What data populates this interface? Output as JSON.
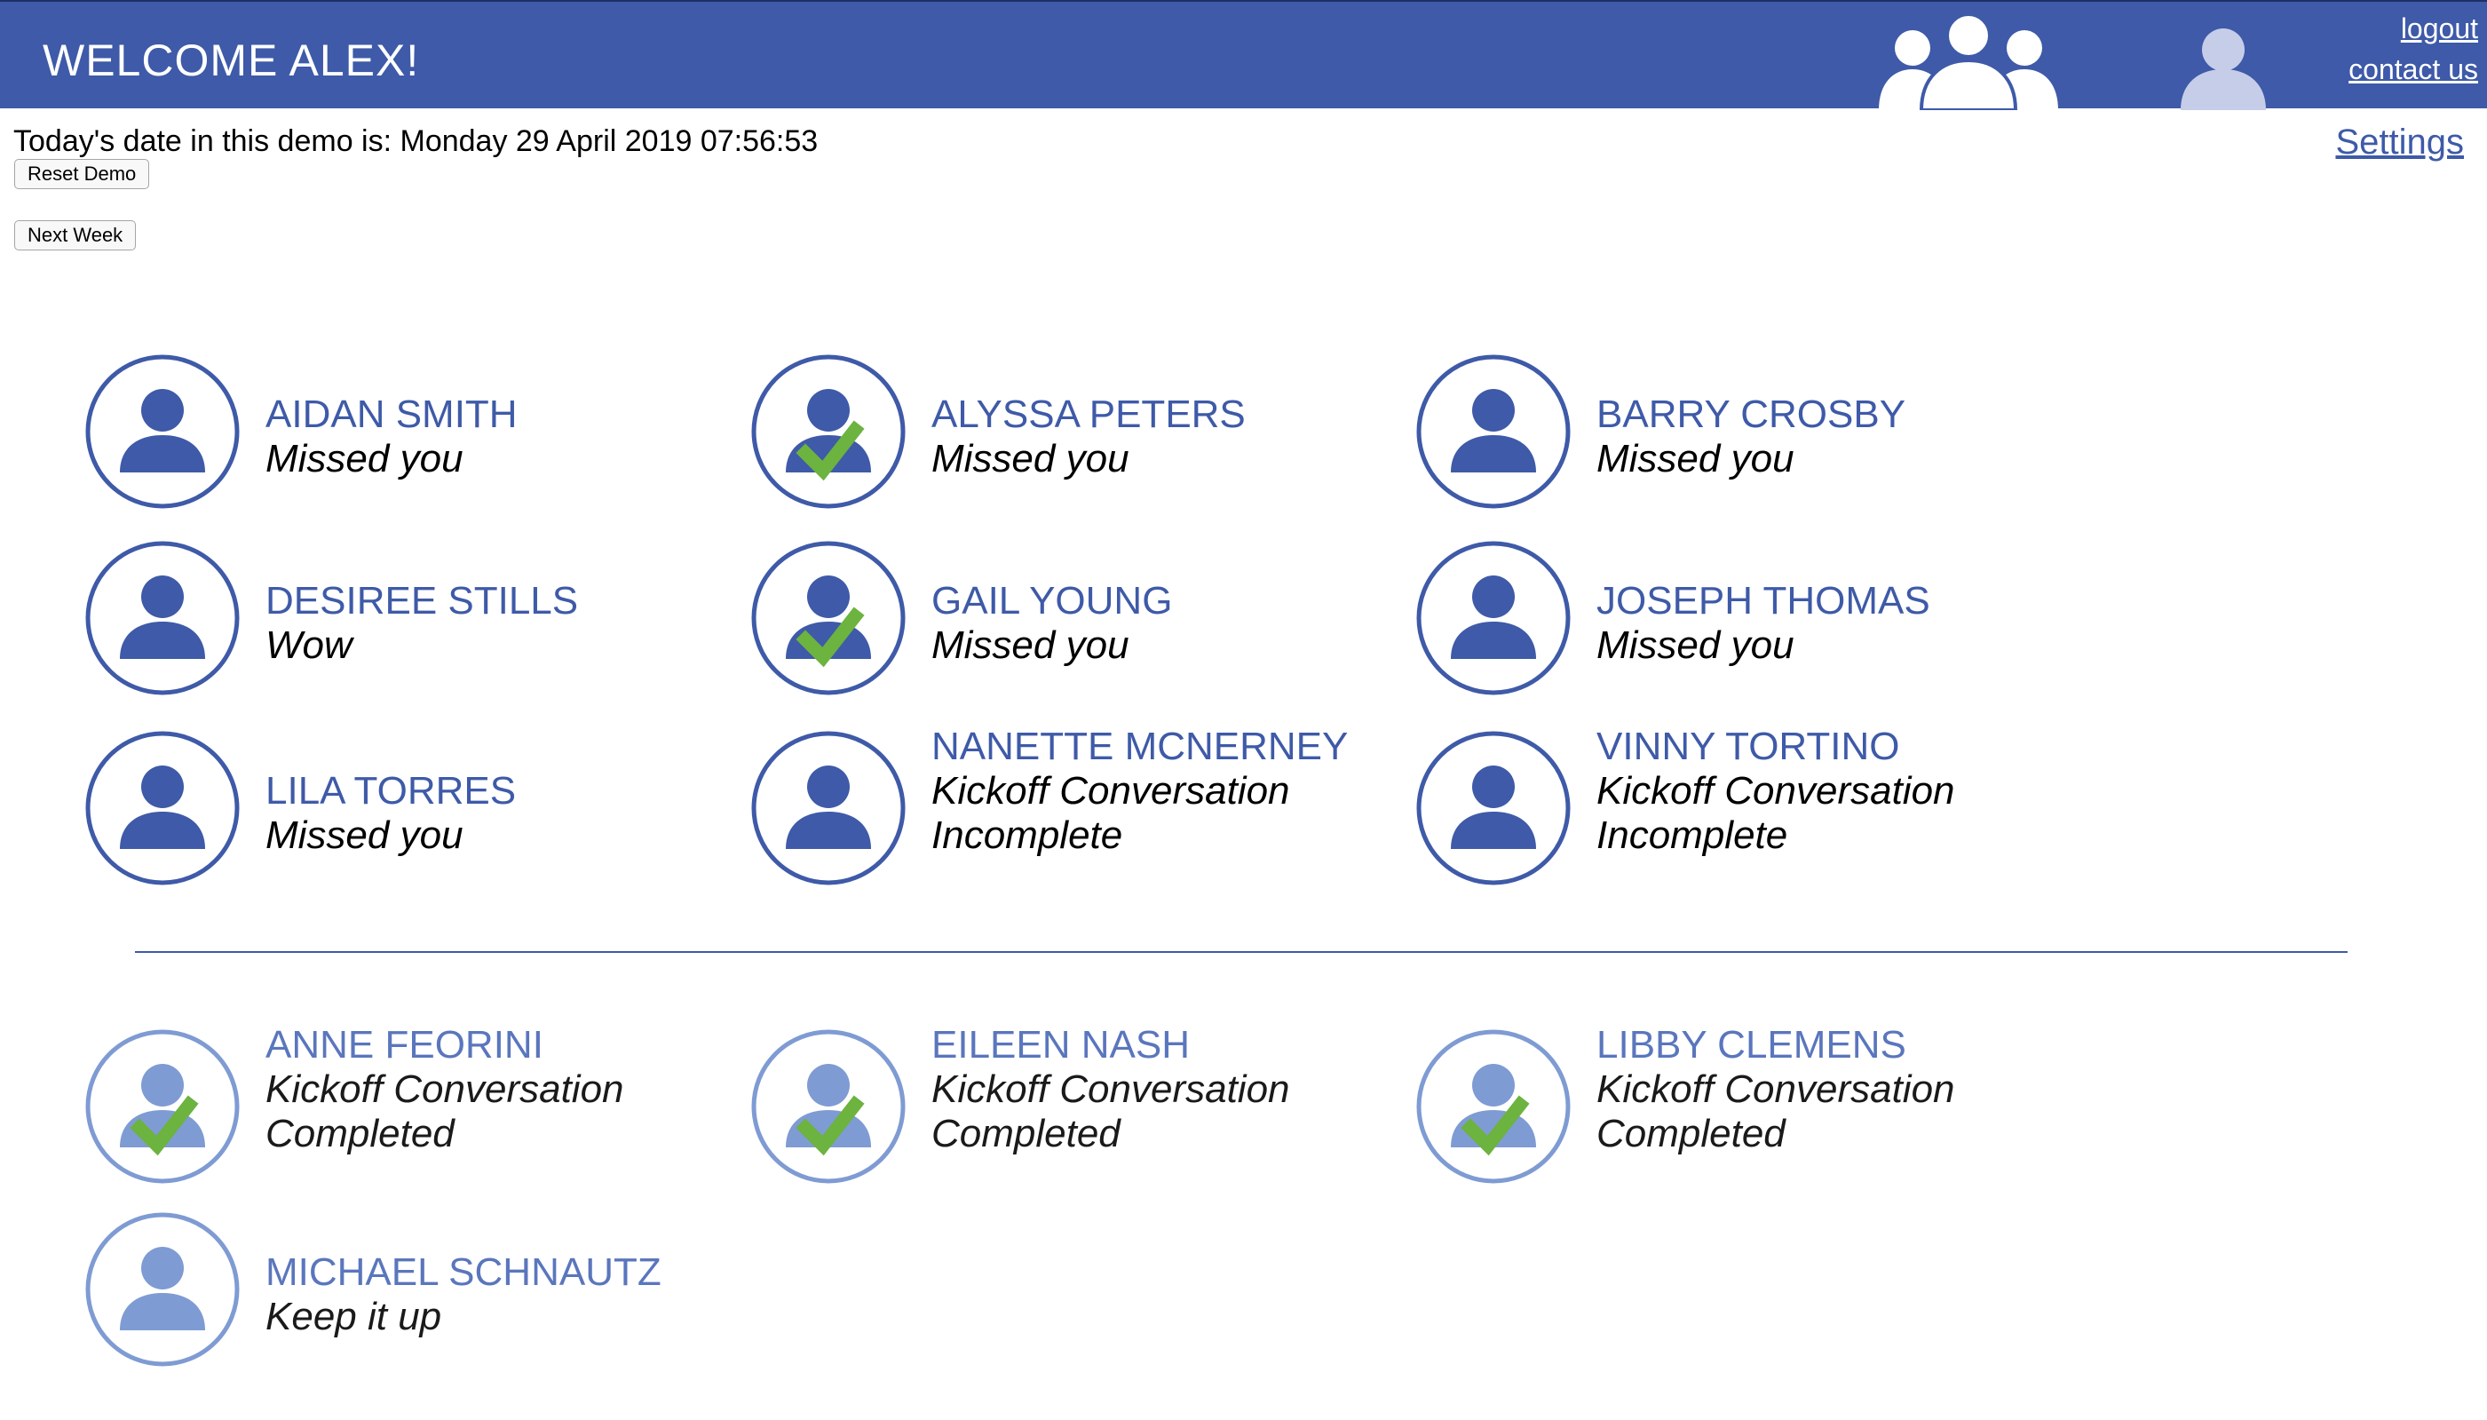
{
  "header": {
    "welcome": "WELCOME ALEX!",
    "logout": "logout",
    "contact": "contact us",
    "group_icon": "group-people-icon",
    "user_icon": "user-profile-icon"
  },
  "controls": {
    "date_text": "Today's date in this demo is: Monday 29 April 2019 07:56:53",
    "reset_label": "Reset Demo",
    "next_week_label": "Next Week",
    "settings_label": "Settings"
  },
  "colors": {
    "header_bg": "#3e5aa8",
    "accent": "#3e5aa8",
    "accent_light": "#7f9bd3",
    "check_green": "#6cb33f"
  },
  "active_people": [
    {
      "name": "AIDAN SMITH",
      "status": [
        "Missed you"
      ],
      "checked": false
    },
    {
      "name": "ALYSSA PETERS",
      "status": [
        "Missed you"
      ],
      "checked": true
    },
    {
      "name": "BARRY CROSBY",
      "status": [
        "Missed you"
      ],
      "checked": false
    },
    {
      "name": "DESIREE STILLS",
      "status": [
        "Wow"
      ],
      "checked": false
    },
    {
      "name": "GAIL YOUNG",
      "status": [
        "Missed you"
      ],
      "checked": true
    },
    {
      "name": "JOSEPH THOMAS",
      "status": [
        "Missed you"
      ],
      "checked": false
    },
    {
      "name": "LILA TORRES",
      "status": [
        "Missed you"
      ],
      "checked": false
    },
    {
      "name": "NANETTE MCNERNEY",
      "status": [
        "Kickoff Conversation",
        "Incomplete"
      ],
      "checked": false
    },
    {
      "name": "VINNY TORTINO",
      "status": [
        "Kickoff Conversation",
        "Incomplete"
      ],
      "checked": false
    }
  ],
  "completed_people": [
    {
      "name": "ANNE FEORINI",
      "status": [
        "Kickoff Conversation",
        "Completed"
      ],
      "checked": true
    },
    {
      "name": "EILEEN NASH",
      "status": [
        "Kickoff Conversation",
        "Completed"
      ],
      "checked": true
    },
    {
      "name": "LIBBY CLEMENS",
      "status": [
        "Kickoff Conversation",
        "Completed"
      ],
      "checked": true
    },
    {
      "name": "MICHAEL SCHNAUTZ",
      "status": [
        "Keep it up"
      ],
      "checked": false
    }
  ]
}
